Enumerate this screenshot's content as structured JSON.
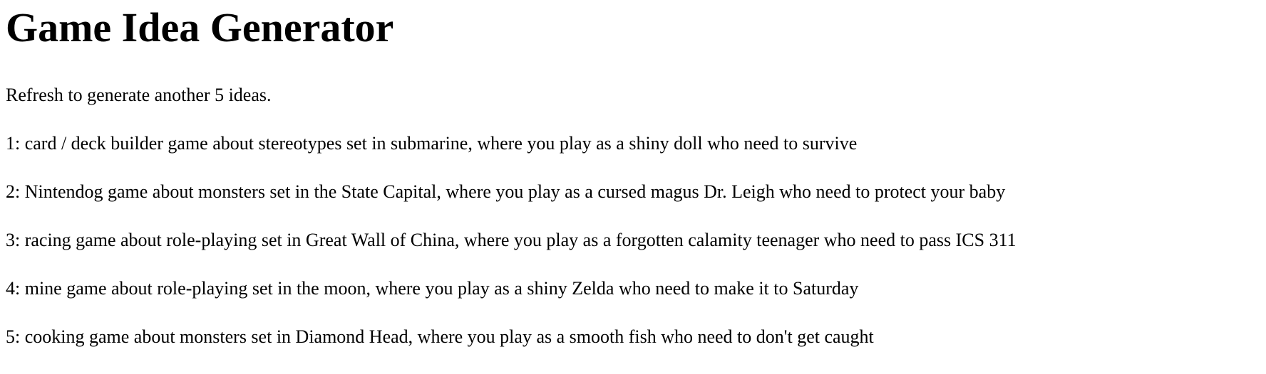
{
  "page": {
    "title": "Game Idea Generator",
    "subtitle": "Refresh to generate another 5 ideas.",
    "ideas": [
      "1: card / deck builder game about stereotypes set in submarine, where you play as a shiny doll who need to survive",
      "2: Nintendog game about monsters set in the State Capital, where you play as a cursed magus Dr. Leigh who need to protect your baby",
      "3: racing game about role-playing set in Great Wall of China, where you play as a forgotten calamity teenager who need to pass ICS 311",
      "4: mine game about role-playing set in the moon, where you play as a shiny Zelda who need to make it to Saturday",
      "5: cooking game about monsters set in Diamond Head, where you play as a smooth fish who need to don't get caught"
    ]
  }
}
